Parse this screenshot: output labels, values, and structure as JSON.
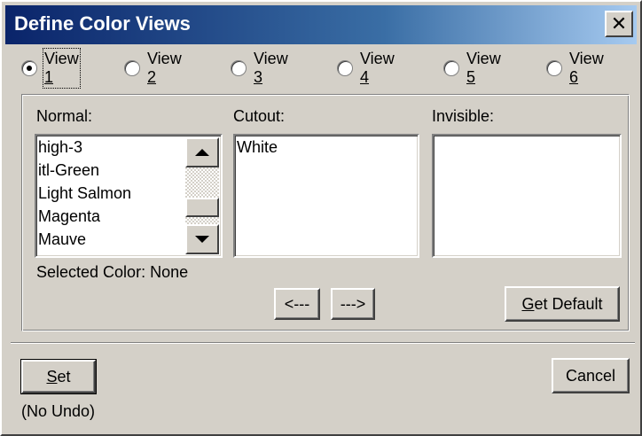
{
  "window": {
    "title": "Define Color Views",
    "close_glyph": "✕"
  },
  "views": [
    {
      "prefix": "View ",
      "key": "1",
      "selected": true
    },
    {
      "prefix": "View ",
      "key": "2",
      "selected": false
    },
    {
      "prefix": "View ",
      "key": "3",
      "selected": false
    },
    {
      "prefix": "View ",
      "key": "4",
      "selected": false
    },
    {
      "prefix": "View ",
      "key": "5",
      "selected": false
    },
    {
      "prefix": "View ",
      "key": "6",
      "selected": false
    }
  ],
  "normal": {
    "label": "Normal:",
    "items": [
      "high-3",
      "itl-Green",
      "Light Salmon",
      "Magenta",
      "Mauve"
    ]
  },
  "cutout": {
    "label": "Cutout:",
    "items": [
      "White"
    ]
  },
  "invisible": {
    "label": "Invisible:",
    "items": []
  },
  "selected_color": "Selected Color: None",
  "buttons": {
    "move_left": "<---",
    "move_right": "--->",
    "get_default_key": "G",
    "get_default_rest": "et Default",
    "set_key": "S",
    "set_rest": "et",
    "cancel": "Cancel"
  },
  "no_undo": "(No Undo)"
}
